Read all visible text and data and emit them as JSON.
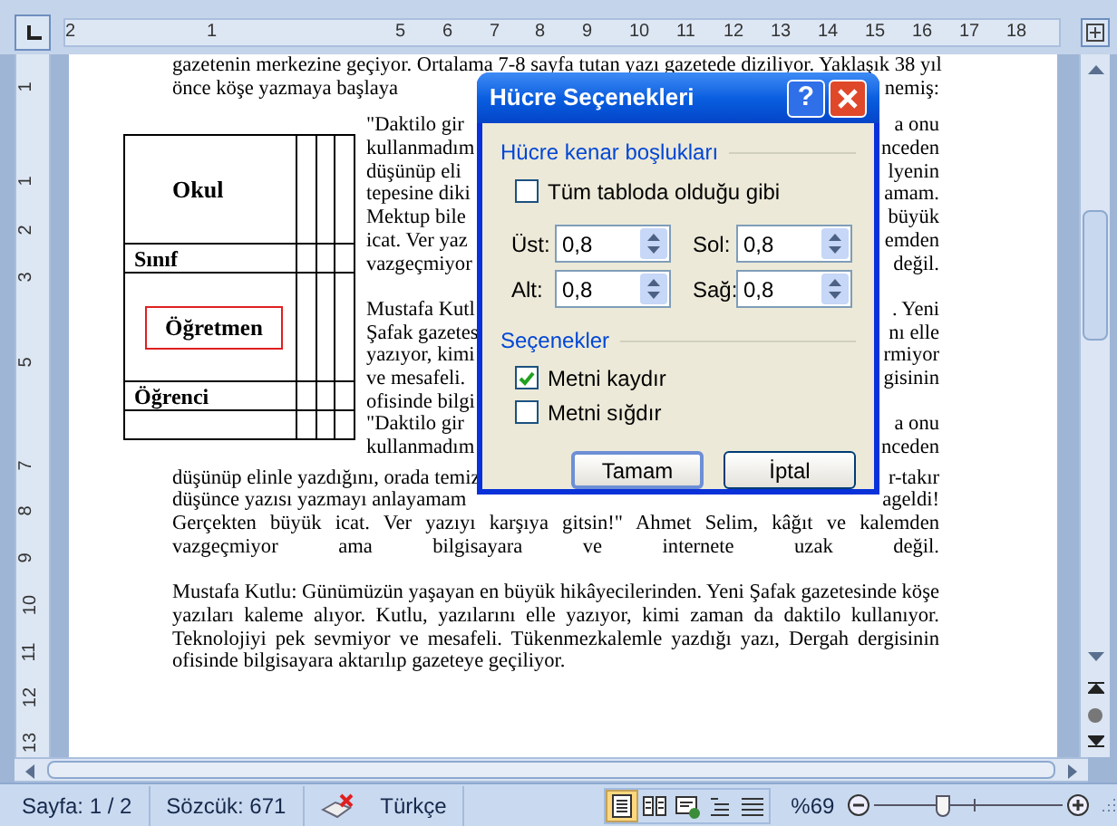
{
  "ruler": {
    "horizontal_marks": [
      "2",
      "1",
      "5",
      "6",
      "7",
      "8",
      "9",
      "10",
      "11",
      "12",
      "13",
      "14",
      "15",
      "16",
      "17",
      "18"
    ],
    "vertical_marks": [
      "1",
      "1",
      "2",
      "3",
      "5",
      "7",
      "8",
      "9",
      "10",
      "11",
      "12",
      "13"
    ]
  },
  "document": {
    "top_lines": [
      {
        "kind": "full",
        "text": "gazetenin merkezine geçiyor. Ortalama 7-8 sayfa tutan yazı gazetede diziliyor. Yaklaşık 38 yıl"
      },
      {
        "kind": "split",
        "left": "önce köşe yazmaya başlaya",
        "right": "nemiş:"
      }
    ],
    "side_lines": [
      {
        "kind": "split",
        "left": "\"Daktilo gir",
        "right": "a onu"
      },
      {
        "kind": "split",
        "left": "kullanmadım",
        "right": "nceden"
      },
      {
        "kind": "split",
        "left": "düşünüp eli",
        "right": "lyenin"
      },
      {
        "kind": "split",
        "left": "tepesine diki",
        "right": "amam."
      },
      {
        "kind": "split",
        "left": "Mektup bile",
        "right": "büyük"
      },
      {
        "kind": "split",
        "left": "icat. Ver yaz",
        "right": "emden"
      },
      {
        "kind": "split",
        "left": "vazgeçmiyor",
        "right": "değil."
      },
      {
        "kind": "blank"
      },
      {
        "kind": "split",
        "left": "Mustafa Kutl",
        "right": ". Yeni"
      },
      {
        "kind": "split",
        "left": "Şafak gazetes",
        "right": "nı elle"
      },
      {
        "kind": "split",
        "left": "yazıyor, kimi",
        "right": "rmiyor"
      },
      {
        "kind": "split",
        "left": "ve mesafeli.",
        "right": "gisinin"
      },
      {
        "kind": "end",
        "text": "ofisinde bilgi"
      },
      {
        "kind": "split",
        "left": "\"Daktilo gir",
        "right": "a onu"
      },
      {
        "kind": "split",
        "left": "kullanmadım",
        "right": "nceden"
      }
    ],
    "table": {
      "rows": [
        {
          "kind": "tall",
          "text": "Okul",
          "framed": false
        },
        {
          "kind": "short",
          "text": "Sınıf",
          "framed": false
        },
        {
          "kind": "tall",
          "text": "Öğretmen",
          "framed": true
        },
        {
          "kind": "short",
          "text": "Öğrenci",
          "framed": false
        },
        {
          "kind": "short"
        }
      ]
    },
    "bottom_lines": [
      {
        "kind": "split",
        "left": "düşünüp elinle yazdığını, orada temiz",
        "right": "r-takır"
      },
      {
        "kind": "split",
        "left": "düşünce yazısı yazmayı anlayamam",
        "right": "ageldi!"
      },
      {
        "kind": "full",
        "text": "Gerçekten büyük icat. Ver yazıyı karşıya gitsin!\" Ahmet Selim, kâğıt ve kalemden"
      },
      {
        "kind": "full",
        "text": "vazgeçmiyor ama bilgisayara ve internete uzak değil."
      },
      {
        "kind": "blank"
      },
      {
        "kind": "full",
        "text": "Mustafa Kutlu: Günümüzün yaşayan en büyük hikâyecilerinden. Yeni Şafak gazetesinde köşe"
      },
      {
        "kind": "full",
        "text": "yazıları kaleme alıyor. Kutlu, yazılarını elle yazıyor, kimi zaman da daktilo kullanıyor."
      },
      {
        "kind": "full",
        "text": "Teknolojiyi pek sevmiyor ve mesafeli. Tükenmezkalemle yazdığı yazı, Dergah dergisinin"
      },
      {
        "kind": "end",
        "text": "ofisinde bilgisayara aktarılıp gazeteye geçiliyor."
      }
    ]
  },
  "dialog": {
    "title": "Hücre Seçenekleri",
    "help_button": "?",
    "margins_section": "Hücre kenar boşlukları",
    "same_as_table": {
      "label": "Tüm tabloda olduğu gibi",
      "checked": false
    },
    "fields": [
      {
        "label": "Üst:",
        "value": "0,8"
      },
      {
        "label": "Sol:",
        "value": "0,8"
      },
      {
        "label": "Alt:",
        "value": "0,8"
      },
      {
        "label": "Sağ:",
        "value": "0,8"
      }
    ],
    "options_section": "Seçenekler",
    "options": [
      {
        "label": "Metni kaydır",
        "checked": true
      },
      {
        "label": "Metni sığdır",
        "checked": false
      }
    ],
    "buttons": [
      {
        "label": "Tamam",
        "default": true
      },
      {
        "label": "İptal",
        "default": false
      }
    ]
  },
  "status_bar": {
    "page": "Sayfa: 1 / 2",
    "words": "Sözcük: 671",
    "language": "Türkçe",
    "views": [
      {
        "kind": "print",
        "selected": true
      },
      {
        "kind": "reading",
        "selected": false
      },
      {
        "kind": "web",
        "selected": false
      },
      {
        "kind": "outline",
        "selected": false
      },
      {
        "kind": "draft",
        "selected": false
      }
    ],
    "zoom": "%69",
    "zoom_slider": {
      "level": 0.36
    }
  }
}
